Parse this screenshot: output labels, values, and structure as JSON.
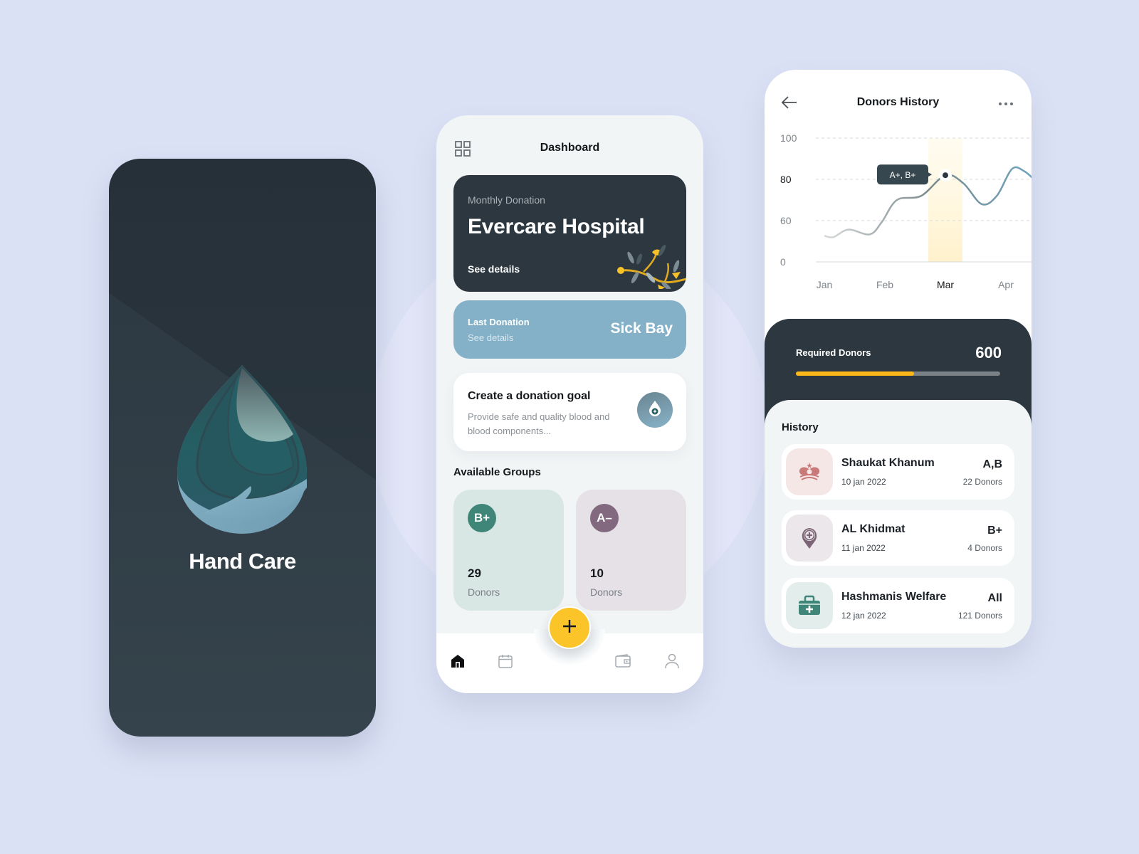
{
  "splash": {
    "app_name": "Hand Care",
    "logo_icon": "blood-drop-hand-icon"
  },
  "dashboard": {
    "title": "Dashboard",
    "menu_icon": "grid-icon",
    "monthly_card": {
      "label": "Monthly Donation",
      "hospital": "Evercare Hospital",
      "link": "See details"
    },
    "last_card": {
      "label": "Last Donation",
      "link": "See details",
      "place": "Sick Bay"
    },
    "goal_card": {
      "title": "Create a donation goal",
      "description": "Provide safe and quality blood and blood components..."
    },
    "groups_title": "Available Groups",
    "groups": [
      {
        "type": "B+",
        "count": "29",
        "unit": "Donors",
        "color": "#3f8678"
      },
      {
        "type": "A–",
        "count": "10",
        "unit": "Donors",
        "color": "#83697f"
      }
    ],
    "fab_icon": "plus-icon",
    "nav": [
      {
        "name": "home",
        "icon": "home-icon",
        "active": true
      },
      {
        "name": "calendar",
        "icon": "calendar-icon",
        "active": false
      },
      {
        "name": "wallet",
        "icon": "wallet-icon",
        "active": false
      },
      {
        "name": "profile",
        "icon": "user-icon",
        "active": false
      }
    ]
  },
  "history_screen": {
    "title": "Donors History",
    "required_label": "Required Donors",
    "required_value": "600",
    "required_progress": 0.58,
    "history_title": "History",
    "items": [
      {
        "name": "Shaukat Khanum",
        "date": "10 jan 2022",
        "group": "A,B",
        "donors": "22 Donors",
        "icon": "crown-icon"
      },
      {
        "name": "AL Khidmat",
        "date": "11 jan 2022",
        "group": "B+",
        "donors": "4 Donors",
        "icon": "location-plus-icon"
      },
      {
        "name": "Hashmanis Welfare",
        "date": "12 jan 2022",
        "group": "All",
        "donors": "121 Donors",
        "icon": "medical-kit-icon"
      }
    ]
  },
  "chart_data": {
    "type": "line",
    "title": "Donors History",
    "x": [
      "Jan",
      "Feb",
      "Mar",
      "Apr"
    ],
    "highlight_category": "Mar",
    "y_ticks": [
      "100",
      "80",
      "60",
      "0"
    ],
    "ylim": [
      0,
      100
    ],
    "grid": true,
    "tooltip": {
      "x": "Mar",
      "y": 82,
      "label": "A+, B+"
    },
    "series": [
      {
        "name": "Donors",
        "points": [
          [
            0.0,
            38
          ],
          [
            0.15,
            36
          ],
          [
            0.4,
            47
          ],
          [
            0.75,
            40
          ],
          [
            0.95,
            58
          ],
          [
            1.2,
            70
          ],
          [
            1.6,
            72
          ],
          [
            2.0,
            82
          ],
          [
            2.3,
            78
          ],
          [
            2.6,
            68
          ],
          [
            2.85,
            72
          ],
          [
            3.1,
            85
          ],
          [
            3.3,
            84
          ],
          [
            3.5,
            79
          ]
        ]
      }
    ]
  },
  "colors": {
    "background": "#dbe1f5",
    "dark": "#2c3740",
    "accent_yellow": "#fbc429",
    "accent_blue": "#84b1c8",
    "teal": "#3f8678",
    "mauve": "#83697f"
  }
}
